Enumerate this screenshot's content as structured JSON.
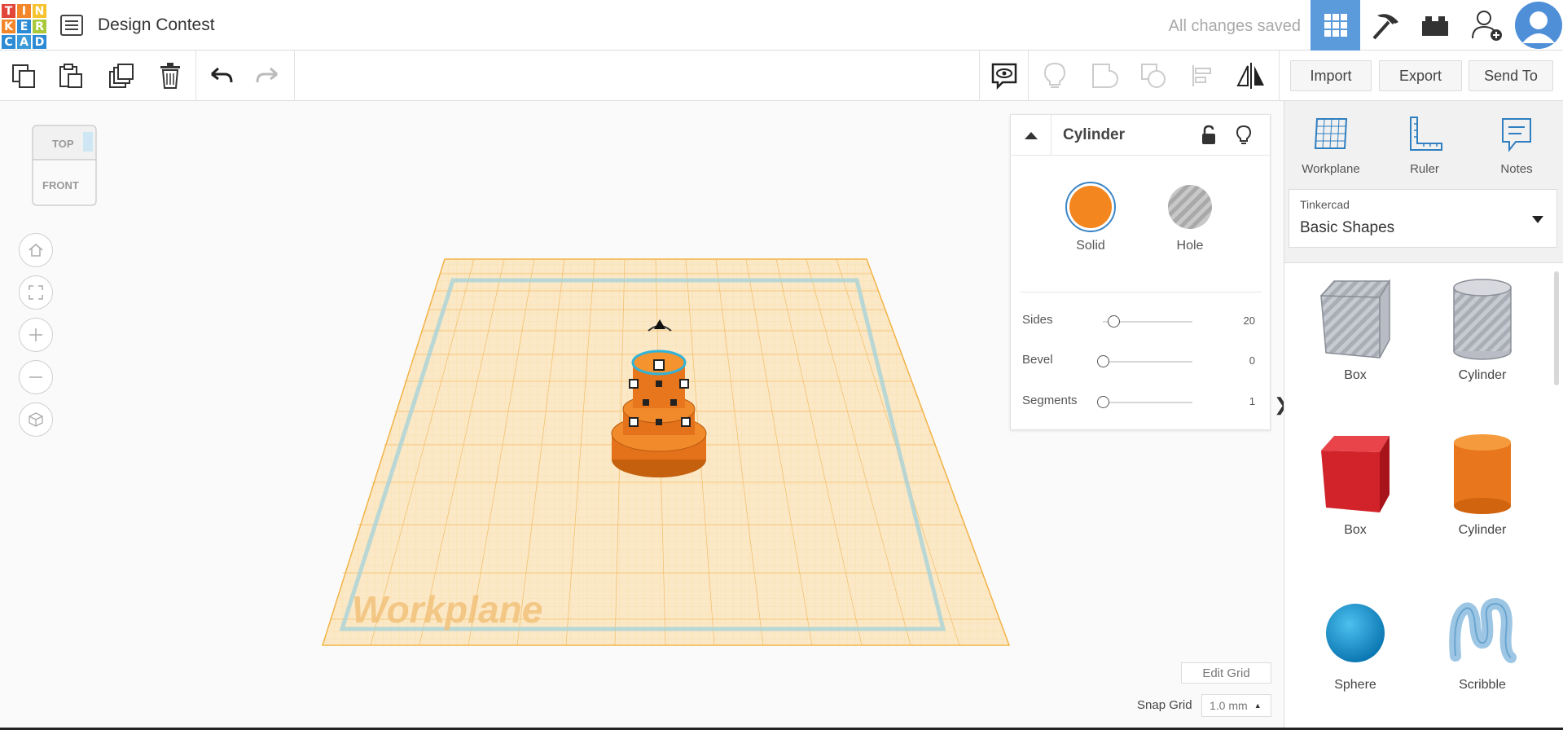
{
  "header": {
    "logo_letters": [
      "T",
      "I",
      "N",
      "K",
      "E",
      "R",
      "C",
      "A",
      "D"
    ],
    "logo_colors": [
      "#e2453a",
      "#f3862a",
      "#f6c22d",
      "#f3862a",
      "#2d8bd6",
      "#a9c93c",
      "#2d8bd6",
      "#3a9ad9",
      "#2d8bd6"
    ],
    "design_title": "Design Contest",
    "save_status": "All changes saved",
    "icons": [
      "design-list-icon",
      "grid-view-icon",
      "pickaxe-icon",
      "bricks-icon",
      "add-user-icon",
      "avatar"
    ]
  },
  "toolbar": {
    "left_icons": [
      "copy-icon",
      "paste-icon",
      "duplicate-icon",
      "delete-icon",
      "undo-icon",
      "redo-icon"
    ],
    "right_icons": [
      "notes-toggle-icon",
      "light-bulb-icon",
      "group-icon",
      "ungroup-icon",
      "align-icon",
      "mirror-icon"
    ],
    "import_label": "Import",
    "export_label": "Export",
    "send_to_label": "Send To"
  },
  "viewcube": {
    "top": "TOP",
    "front": "FRONT"
  },
  "nav_buttons": [
    "home-view-icon",
    "fit-view-icon",
    "zoom-in-icon",
    "zoom-out-icon",
    "perspective-icon"
  ],
  "workplane": {
    "watermark": "Workplane",
    "grid_color": "#f3b548"
  },
  "inspector": {
    "title": "Cylinder",
    "solid_label": "Solid",
    "hole_label": "Hole",
    "solid_color": "#f3861f",
    "props": [
      {
        "name": "Sides",
        "value": "20",
        "fraction": 0.12
      },
      {
        "name": "Bevel",
        "value": "0",
        "fraction": 0.0
      },
      {
        "name": "Segments",
        "value": "1",
        "fraction": 0.0
      }
    ]
  },
  "bottom": {
    "edit_grid": "Edit Grid",
    "snap_label": "Snap Grid",
    "snap_value": "1.0 mm"
  },
  "right_panel": {
    "tools": [
      "Workplane",
      "Ruler",
      "Notes"
    ],
    "library_source": "Tinkercad",
    "library_name": "Basic Shapes",
    "shapes": [
      {
        "label": "Box",
        "kind": "hole-box"
      },
      {
        "label": "Cylinder",
        "kind": "hole-cylinder"
      },
      {
        "label": "Box",
        "kind": "solid-box",
        "color": "#d2232a"
      },
      {
        "label": "Cylinder",
        "kind": "solid-cylinder",
        "color": "#ef7d16"
      },
      {
        "label": "Sphere",
        "kind": "sphere",
        "color": "#1a9ad6"
      },
      {
        "label": "Scribble",
        "kind": "scribble",
        "color": "#9cc6e4"
      }
    ]
  }
}
